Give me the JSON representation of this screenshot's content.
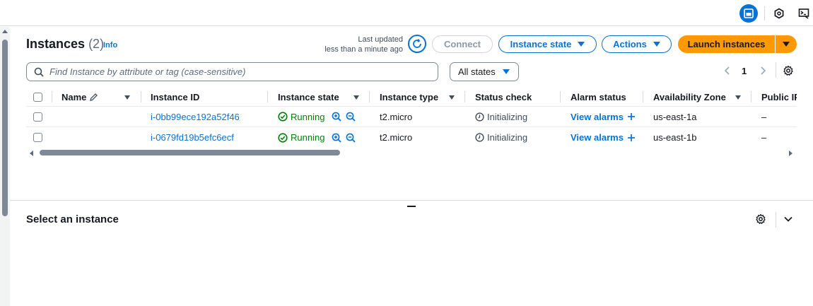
{
  "colors": {
    "accent": "#0972d3",
    "launch": "#ff9900",
    "running": "#037f0c"
  },
  "topbar": {
    "icons": [
      "panel-icon",
      "hexagon-icon",
      "terminal-icon"
    ]
  },
  "header": {
    "title": "Instances",
    "count": "(2)",
    "info": "Info",
    "last_updated_label": "Last updated",
    "last_updated_value": "less than a minute ago"
  },
  "toolbar": {
    "connect": "Connect",
    "instance_state": "Instance state",
    "actions": "Actions",
    "launch": "Launch instances"
  },
  "search": {
    "placeholder": "Find Instance by attribute or tag (case-sensitive)"
  },
  "filter": {
    "selected": "All states"
  },
  "pagination": {
    "page": "1"
  },
  "table": {
    "columns": [
      "Name",
      "Instance ID",
      "Instance state",
      "Instance type",
      "Status check",
      "Alarm status",
      "Availability Zone",
      "Public IP"
    ],
    "rows": [
      {
        "name": "",
        "instance_id": "i-0bb99ece192a52f46",
        "state": "Running",
        "type": "t2.micro",
        "status": "Initializing",
        "alarm": "View alarms",
        "zone": "us-east-1a",
        "public_ip": "–"
      },
      {
        "name": "",
        "instance_id": "i-0679fd19b5efc6ecf",
        "state": "Running",
        "type": "t2.micro",
        "status": "Initializing",
        "alarm": "View alarms",
        "zone": "us-east-1b",
        "public_ip": "–"
      }
    ]
  },
  "details": {
    "title": "Select an instance"
  }
}
